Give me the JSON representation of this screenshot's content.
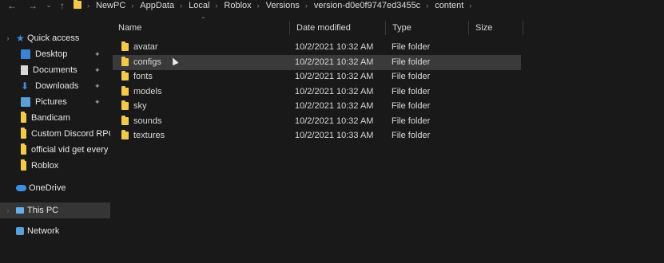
{
  "breadcrumbs": [
    "NewPC",
    "AppData",
    "Local",
    "Roblox",
    "Versions",
    "version-d0e0f9747ed3455c",
    "content"
  ],
  "columns": {
    "name": "Name",
    "date": "Date modified",
    "type": "Type",
    "size": "Size"
  },
  "sidebar": {
    "quick_access": "Quick access",
    "items": [
      {
        "label": "Desktop",
        "icon": "desktop-icon",
        "pinned": true
      },
      {
        "label": "Documents",
        "icon": "documents-icon",
        "pinned": true
      },
      {
        "label": "Downloads",
        "icon": "downloads-icon",
        "pinned": true
      },
      {
        "label": "Pictures",
        "icon": "pictures-icon",
        "pinned": true
      },
      {
        "label": "Bandicam",
        "icon": "folder-icon"
      },
      {
        "label": "Custom Discord RPC",
        "icon": "folder-icon"
      },
      {
        "label": "official vid get every",
        "icon": "folder-icon"
      },
      {
        "label": "Roblox",
        "icon": "folder-icon"
      }
    ],
    "onedrive": "OneDrive",
    "this_pc": "This PC",
    "network": "Network"
  },
  "files": [
    {
      "name": "avatar",
      "date": "10/2/2021 10:32 AM",
      "type": "File folder"
    },
    {
      "name": "configs",
      "date": "10/2/2021 10:32 AM",
      "type": "File folder"
    },
    {
      "name": "fonts",
      "date": "10/2/2021 10:32 AM",
      "type": "File folder"
    },
    {
      "name": "models",
      "date": "10/2/2021 10:32 AM",
      "type": "File folder"
    },
    {
      "name": "sky",
      "date": "10/2/2021 10:32 AM",
      "type": "File folder"
    },
    {
      "name": "sounds",
      "date": "10/2/2021 10:32 AM",
      "type": "File folder"
    },
    {
      "name": "textures",
      "date": "10/2/2021 10:33 AM",
      "type": "File folder"
    }
  ],
  "colors": {
    "background": "#191919",
    "folder": "#f2c94c",
    "selected_row": "#3a3a3a",
    "selected_nav": "#353535"
  }
}
